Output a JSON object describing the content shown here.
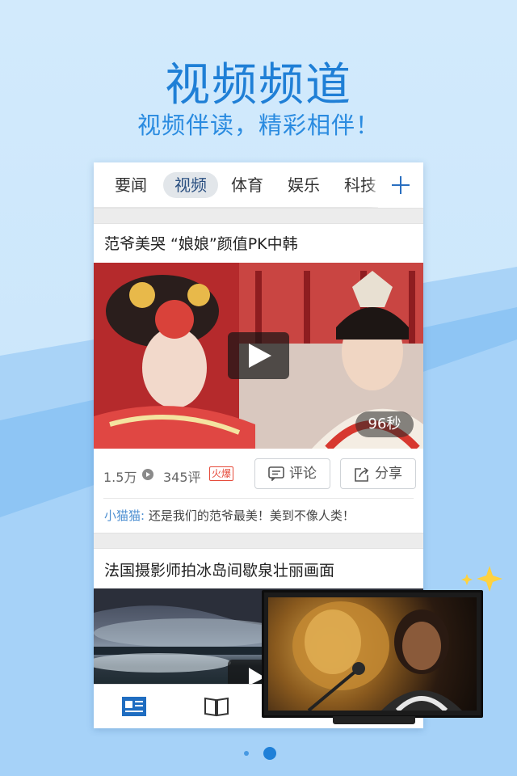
{
  "promo": {
    "headline": "视频频道",
    "subline": "视频伴读，精彩相伴！"
  },
  "tabs": [
    {
      "label": "要闻",
      "active": false
    },
    {
      "label": "视频",
      "active": true
    },
    {
      "label": "体育",
      "active": false
    },
    {
      "label": "娱乐",
      "active": false
    },
    {
      "label": "科技",
      "active": false
    }
  ],
  "tab_add_icon": "plus-icon",
  "feed": [
    {
      "title": "范爷美哭 “娘娘”颜值PK中韩",
      "duration": "96秒",
      "views": "1.5万",
      "comments_count": "345评",
      "badge": "火爆",
      "comment_button": "评论",
      "share_button": "分享",
      "top_comment_user": "小猫猫:",
      "top_comment_text": "还是我们的范爷最美！美到不像人类！"
    },
    {
      "title": "法国摄影师拍冰岛间歇泉壮丽画面"
    }
  ],
  "bottom_nav": {
    "icons": [
      "news-icon",
      "book-icon"
    ]
  },
  "pager": {
    "pages": 2,
    "current": 2
  },
  "colors": {
    "accent": "#1f7fd6",
    "badge": "#e64b3b",
    "user_link": "#4d8fd1"
  }
}
